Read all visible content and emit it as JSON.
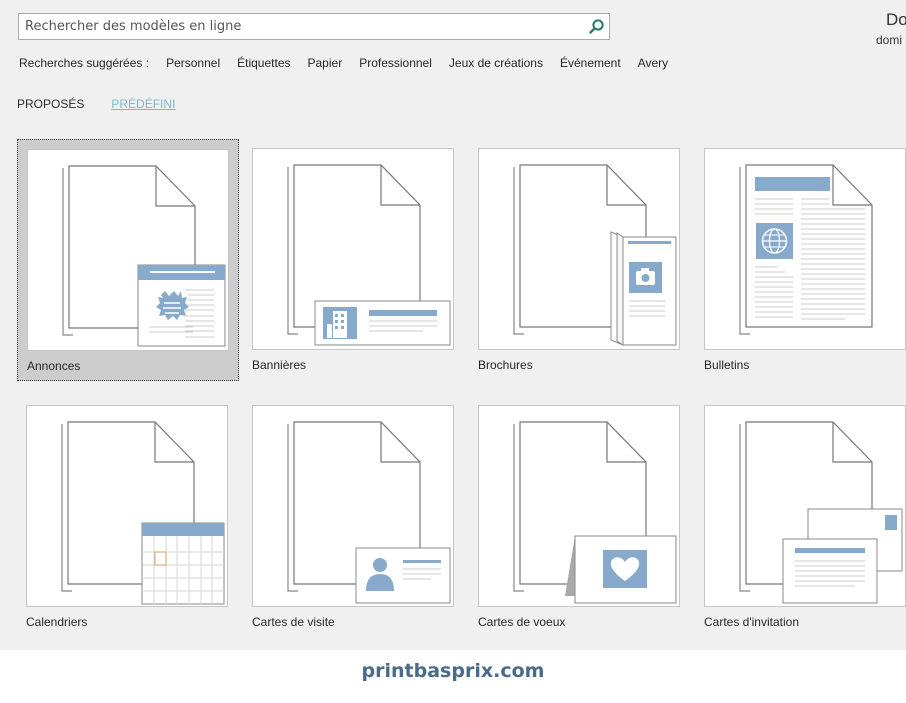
{
  "search": {
    "placeholder": "Rechercher des modèles en ligne"
  },
  "account": {
    "name": "Do",
    "sub": "domi"
  },
  "suggested": {
    "label": "Recherches suggérées :",
    "links": [
      "Personnel",
      "Étiquettes",
      "Papier",
      "Professionnel",
      "Jeux de créations",
      "Événement",
      "Avery"
    ]
  },
  "tabs": [
    {
      "label": "PROPOSÉS",
      "active": false
    },
    {
      "label": "PRÉDÉFINI",
      "active": true
    }
  ],
  "templates": [
    {
      "label": "Annonces",
      "icon": "announcement-icon",
      "selected": true
    },
    {
      "label": "Bannières",
      "icon": "banner-icon",
      "selected": false
    },
    {
      "label": "Brochures",
      "icon": "brochure-icon",
      "selected": false
    },
    {
      "label": "Bulletins",
      "icon": "newsletter-icon",
      "selected": false
    },
    {
      "label": "Calendriers",
      "icon": "calendar-icon",
      "selected": false
    },
    {
      "label": "Cartes de visite",
      "icon": "business-card-icon",
      "selected": false
    },
    {
      "label": "Cartes de voeux",
      "icon": "greeting-card-icon",
      "selected": false
    },
    {
      "label": "Cartes d'invitation",
      "icon": "invitation-icon",
      "selected": false
    }
  ],
  "watermark": "printbasprix.com",
  "colors": {
    "background": "#f0f0f0",
    "accent_blue": "#87a9cc",
    "tab_active": "#7fb9c9",
    "search_icon": "#2a7a5e"
  }
}
